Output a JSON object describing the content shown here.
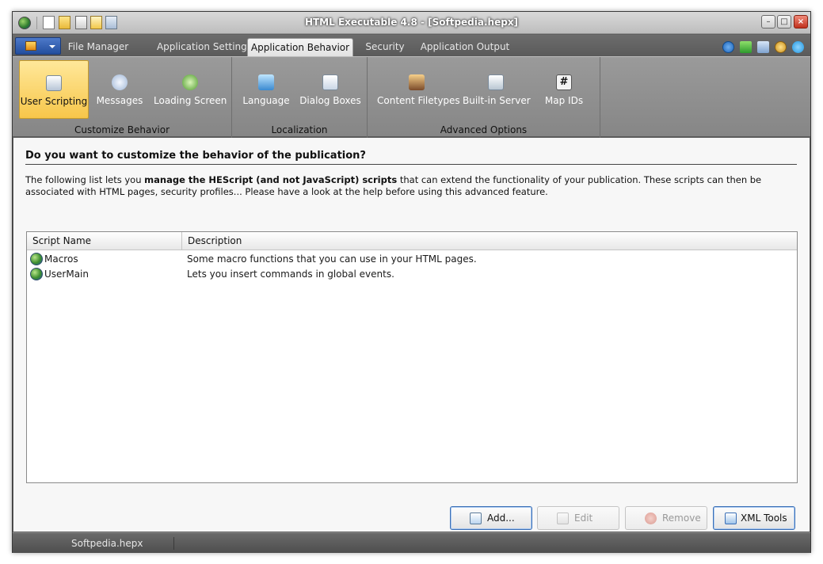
{
  "window": {
    "title": "HTML Executable 4.8 - [Softpedia.hepx]"
  },
  "quick_access": [
    "new-document-icon",
    "open-folder-icon",
    "save-icon",
    "build-icon",
    "preview-icon"
  ],
  "tabs": [
    {
      "label": "File Manager",
      "active": false
    },
    {
      "label": "Application Settings",
      "active": false
    },
    {
      "label": "Application Behavior",
      "active": true
    },
    {
      "label": "Security",
      "active": false
    },
    {
      "label": "Application Output",
      "active": false
    }
  ],
  "header_icons": [
    "help-icon",
    "update-arrow-icon",
    "user-profile-icon",
    "award-icon",
    "twitter-icon"
  ],
  "ribbon": {
    "groups": [
      {
        "label": "Customize Behavior",
        "buttons": [
          {
            "label": "User Scripting",
            "icon": "script-icon",
            "selected": true
          },
          {
            "label": "Messages",
            "icon": "message-bubble-icon",
            "selected": false
          },
          {
            "label": "Loading Screen",
            "icon": "loading-icon",
            "selected": false
          }
        ]
      },
      {
        "label": "Localization",
        "buttons": [
          {
            "label": "Language",
            "icon": "language-icon",
            "selected": false
          },
          {
            "label": "Dialog Boxes",
            "icon": "dialog-icon",
            "selected": false
          }
        ]
      },
      {
        "label": "Advanced Options",
        "buttons": [
          {
            "label": "Content Filetypes",
            "icon": "filetypes-icon",
            "selected": false
          },
          {
            "label": "Built-in Server",
            "icon": "server-icon",
            "selected": false
          },
          {
            "label": "Map IDs",
            "icon": "hash-icon",
            "selected": false
          }
        ]
      }
    ]
  },
  "content": {
    "heading": "Do you want to customize the behavior of the publication?",
    "desc_part1": "The following list lets you ",
    "desc_bold": "manage the HEScript (and not JavaScript) scripts",
    "desc_part2": " that can extend the functionality of your publication. These scripts can then be associated with HTML pages, security profiles... Please have a look at the help before using this advanced feature.",
    "list": {
      "columns": [
        "Script Name",
        "Description"
      ],
      "rows": [
        {
          "name": "Macros",
          "description": "Some macro functions that you can use in your HTML pages."
        },
        {
          "name": "UserMain",
          "description": "Lets you insert commands in global events."
        }
      ]
    },
    "buttons": {
      "add": "Add...",
      "edit": "Edit",
      "remove": "Remove",
      "xml_tools": "XML Tools"
    }
  },
  "status": {
    "filename": "Softpedia.hepx"
  },
  "colors": {
    "selected_ribbon": "#f7c64a",
    "app_menu": "#234e9e",
    "frame": "#5f5f5f"
  }
}
